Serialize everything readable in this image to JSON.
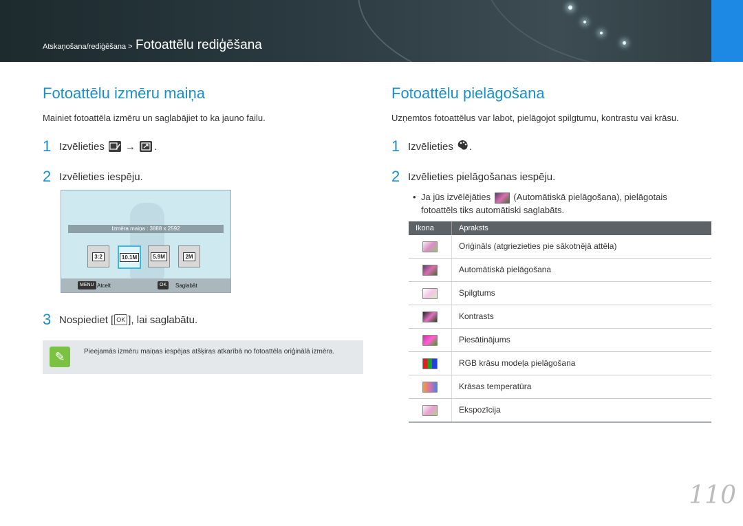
{
  "header": {
    "crumb_small": "Atskaņošana/rediģēšana >",
    "crumb_big": "Fotoattēlu rediģēšana"
  },
  "left": {
    "title": "Fotoattēlu izmēru maiņa",
    "intro": "Mainiet fotoattēla izmēru un saglabājiet to ka jauno failu.",
    "step1_num": "1",
    "step1_text": "Izvēlieties",
    "step1_arrow": "→",
    "step1_end": ".",
    "step2_num": "2",
    "step2_text": "Izvēlieties iespēju.",
    "screen": {
      "caption": "Izmēra maiņa : 3888 x 2592",
      "options": [
        "3:2",
        "10.1M",
        "5.9M",
        "2M"
      ],
      "menu_key": "MENU",
      "menu_label": "Atcelt",
      "ok_key": "OK",
      "ok_label": "Saglabāt"
    },
    "step3_num": "3",
    "step3_text": "Nospiediet [",
    "step3_key": "OK",
    "step3_end": "], lai saglabātu.",
    "note": "Pieejamās izmēru maiņas iespējas atšķiras atkarībā no fotoattēla oriģinālā izmēra."
  },
  "right": {
    "title": "Fotoattēlu pielāgošana",
    "intro": "Uzņemtos fotoattēlus var labot, pielāgojot spilgtumu, kontrastu vai krāsu.",
    "step1_num": "1",
    "step1_text": "Izvēlieties",
    "step1_end": ".",
    "step2_num": "2",
    "step2_text": "Izvēlieties pielāgošanas iespēju.",
    "bullet_a": "Ja jūs izvēlējāties",
    "bullet_b": "(Automātiskā pielāgošana), pielāgotais fotoattēls tiks automātiski saglabāts.",
    "table": {
      "col_icon": "Ikona",
      "col_desc": "Apraksts",
      "rows": [
        "Oriģināls (atgriezieties pie sākotnējā attēla)",
        "Automātiskā pielāgošana",
        "Spilgtums",
        "Kontrasts",
        "Piesātinājums",
        "RGB krāsu modeļa pielāgošana",
        "Krāsas temperatūra",
        "Ekspozīcija"
      ]
    }
  },
  "page_number": "110"
}
